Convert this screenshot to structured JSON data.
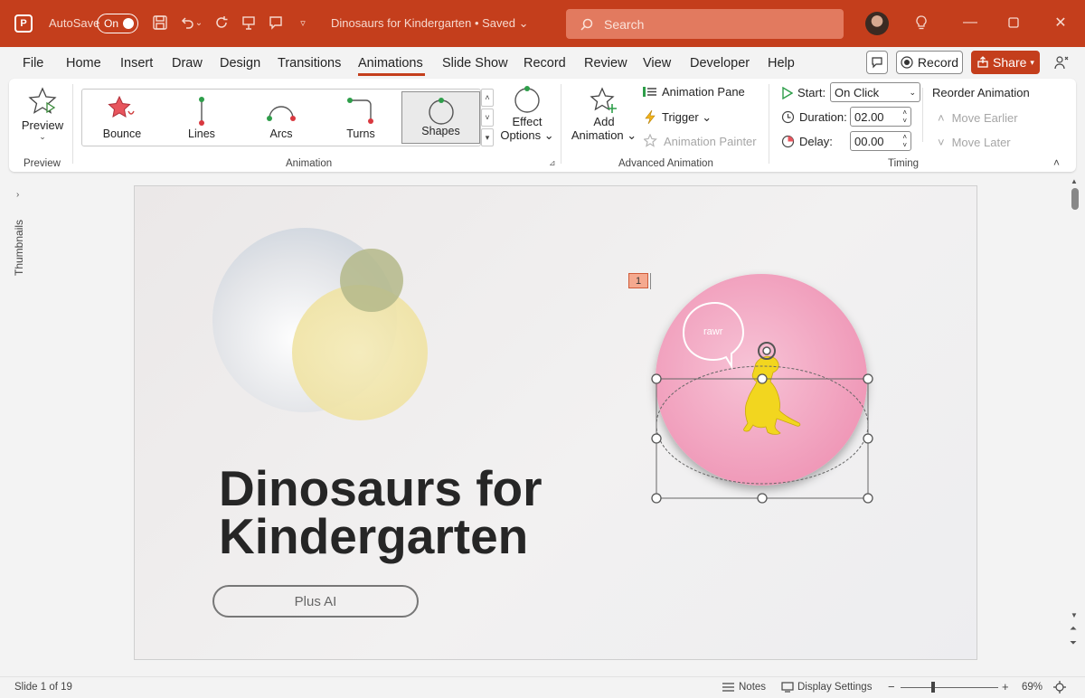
{
  "titlebar": {
    "autosave_label": "AutoSave",
    "autosave_state": "On",
    "doc_title": "Dinosaurs for Kindergarten • Saved ⌄",
    "search_placeholder": "Search"
  },
  "menu": {
    "tabs": [
      "File",
      "Home",
      "Insert",
      "Draw",
      "Design",
      "Transitions",
      "Animations",
      "Slide Show",
      "Record",
      "Review",
      "View",
      "Developer",
      "Help"
    ],
    "active_tab": "Animations",
    "record_label": "Record",
    "share_label": "Share"
  },
  "ribbon": {
    "preview": {
      "label": "Preview",
      "group": "Preview"
    },
    "animation_group": "Animation",
    "gallery": [
      {
        "label": "Bounce"
      },
      {
        "label": "Lines"
      },
      {
        "label": "Arcs"
      },
      {
        "label": "Turns"
      },
      {
        "label": "Shapes",
        "selected": true
      }
    ],
    "effect_options": {
      "line1": "Effect",
      "line2": "Options ⌄"
    },
    "advanced": {
      "group": "Advanced Animation",
      "add_animation_1": "Add",
      "add_animation_2": "Animation ⌄",
      "animation_pane": "Animation Pane",
      "trigger": "Trigger ⌄",
      "animation_painter": "Animation Painter"
    },
    "timing": {
      "group": "Timing",
      "start_label": "Start:",
      "start_value": "On Click",
      "duration_label": "Duration:",
      "duration_value": "02.00",
      "delay_label": "Delay:",
      "delay_value": "00.00",
      "reorder_label": "Reorder Animation",
      "move_earlier": "Move Earlier",
      "move_later": "Move Later"
    }
  },
  "sidebar": {
    "thumbnails_label": "Thumbnails"
  },
  "slide": {
    "title_line1": "Dinosaurs for",
    "title_line2": "Kindergarten",
    "button_label": "Plus AI",
    "anim_tag": "1",
    "bubble_text": "rawr"
  },
  "statusbar": {
    "slide_info": "Slide 1 of 19",
    "notes_label": "Notes",
    "display_settings_label": "Display Settings",
    "zoom_label": "69%",
    "zoom_value": 0.69
  },
  "colors": {
    "brand": "#c43e1c",
    "slide_circle": "#f4a6c4",
    "dino": "#f2d61f"
  }
}
